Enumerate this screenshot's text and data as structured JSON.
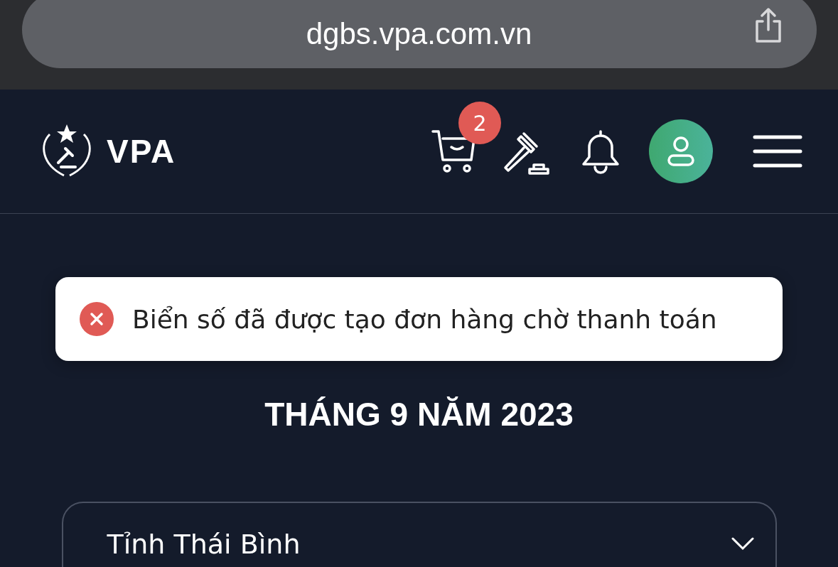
{
  "browser": {
    "url": "dgbs.vpa.com.vn"
  },
  "header": {
    "logo_text": "VPA",
    "cart_count": "2"
  },
  "toast": {
    "kind": "error",
    "message": "Biển số đã được tạo đơn hàng chờ thanh toán"
  },
  "heading": "THÁNG 9 NĂM 2023",
  "province_select": {
    "value": "Tỉnh Thái Bình"
  }
}
